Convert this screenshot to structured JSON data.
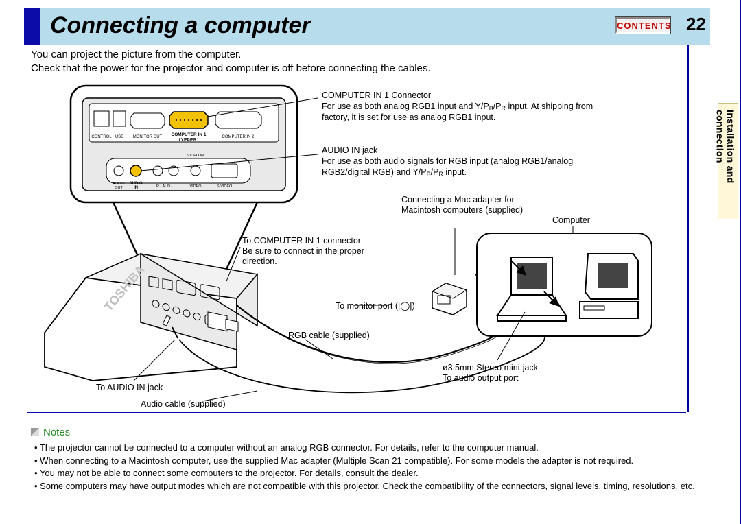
{
  "header": {
    "title": "Connecting a computer",
    "contents_label": "CONTENTS",
    "page_number": "22"
  },
  "side_tab": {
    "line1": "Installation and",
    "line2": "connection"
  },
  "intro": {
    "l1": "You can project the picture from the computer.",
    "l2": "Check that the power for the projector and computer is off before connecting the cables."
  },
  "callouts": {
    "comp_in_title": "COMPUTER IN 1 Connector",
    "comp_in_desc1": "For use as both analog RGB1 input and Y/P",
    "comp_in_desc1_sub1": "B",
    "comp_in_desc1_mid": "/P",
    "comp_in_desc1_sub2": "R",
    "comp_in_desc1_end": " input. At shipping from",
    "comp_in_desc2": "factory, it is set for use as analog RGB1 input.",
    "audio_in_title": "AUDIO IN jack",
    "audio_in_desc1": "For use as both audio signals for RGB input (analog RGB1/analog",
    "audio_in_desc2a": "RGB2/digital RGB) and Y/P",
    "audio_in_desc2_sub1": "B",
    "audio_in_desc2_mid": "/P",
    "audio_in_desc2_sub2": "R",
    "audio_in_desc2_end": " input.",
    "to_comp_in": "To COMPUTER IN 1 connector",
    "to_comp_in2": "Be sure to connect in the proper",
    "to_comp_in3": "direction.",
    "mac_adapter1": "Connecting a Mac adapter for",
    "mac_adapter2": "Macintosh computers (supplied)",
    "computer_label": "Computer",
    "to_monitor": "To monitor port (",
    "to_monitor_end": ")",
    "rgb_cable": "RGB cable (supplied)",
    "to_audio_in": "To AUDIO IN jack",
    "audio_cable": "Audio cable (supplied)",
    "stereo1": "ø3.5mm Stereo mini-jack",
    "stereo2": "To audio output port"
  },
  "panel_labels": {
    "control": "CONTROL",
    "usb": "USB",
    "monitor_out": "MONITOR OUT",
    "computer_in1": "COMPUTER IN 1",
    "computer_in1_sub": "( Y/PB/PR )",
    "computer_in2": "COMPUTER IN 2",
    "audio_out": "AUDIO",
    "out": "OUT",
    "audio_in": "AUDIO",
    "in": "IN",
    "r_aud": "R - AUD - L",
    "video": "VIDEO",
    "svideo": "S-VIDEO",
    "video_in": "VIDEO IN"
  },
  "brand": "TOSHIBA",
  "notes": {
    "heading": "Notes",
    "items": [
      "The projector cannot be connected to a computer without an analog RGB connector. For details, refer to the computer manual.",
      "When connecting to a Macintosh computer, use the supplied Mac adapter (Multiple Scan 21 compatible). For some models the adapter is not required.",
      "You may not be able to connect some computers to the projector. For details, consult the dealer.",
      "Some computers may have output modes which are not compatible with this projector. Check the compatibility of the connectors, signal levels, timing, resolutions, etc."
    ]
  }
}
